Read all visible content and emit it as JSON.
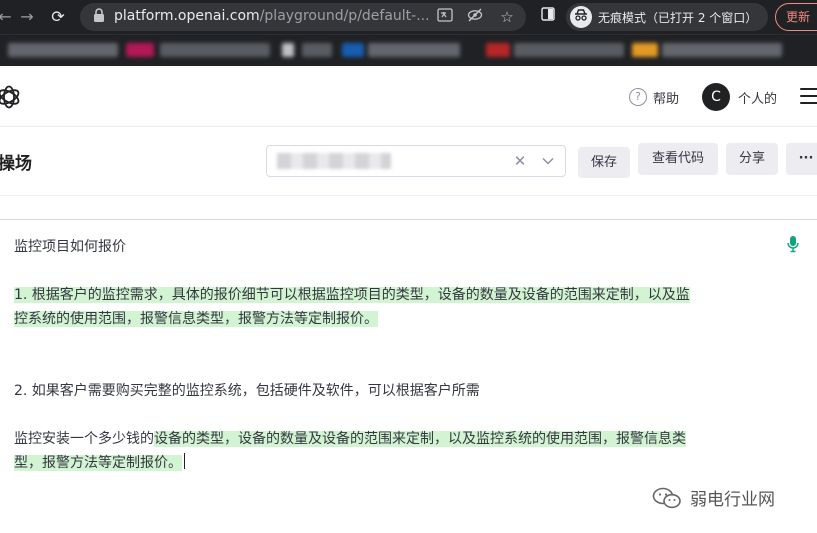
{
  "browser": {
    "url_host": "platform.openai.com",
    "url_path": "/playground/p/default-...",
    "incognito_label": "无痕模式（已打开 2 个窗口）",
    "update_label": "更新"
  },
  "header": {
    "help_label": "帮助",
    "avatar_initial": "C",
    "personal_label": "个人的"
  },
  "toolbar": {
    "title": "操场",
    "preset_value": "",
    "save_label": "保存",
    "view_code_label": "查看代码",
    "share_label": "分享",
    "more_label": "···"
  },
  "editor": {
    "prompt": "监控项目如何报价",
    "p1_line1": "1. 根据客户的监控需求，具体的报价细节可以根据监控项目的类型，设备的数量及设备的范围来定制，以及监",
    "p1_line2": "控系统的使用范围，报警信息类型，报警方法等定制报价。",
    "p2": "2. 如果客户需要购买完整的监控系统，包括硬件及软件，可以根据客户所需",
    "p3_line1_plain": "监控安装一个多少钱的",
    "p3_line1_hl": "设备的类型，设备的数量及设备的范围来定制，以及监控系统的使用范围，报警信息类",
    "p3_line2": "型，报警方法等定制报价。"
  },
  "watermark": {
    "text": "弱电行业网"
  },
  "colors": {
    "highlight": "#d2f4d3",
    "accent": "#10a37f",
    "chrome": "#202124"
  }
}
